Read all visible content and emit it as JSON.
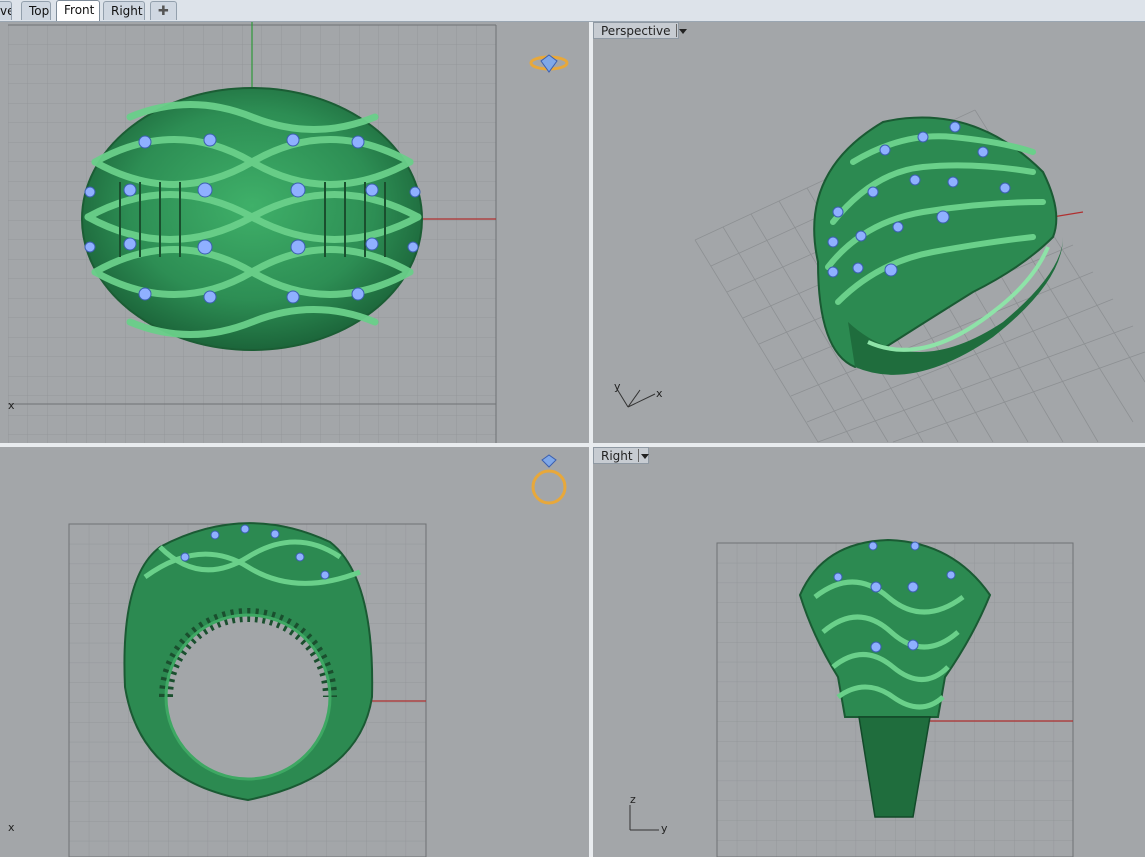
{
  "tabs": [
    {
      "label": "ve",
      "active": false
    },
    {
      "label": "Top",
      "active": false
    },
    {
      "label": "Front",
      "active": true
    },
    {
      "label": "Right",
      "active": false
    }
  ],
  "add_tab_icon": "plus-icon",
  "viewports": {
    "perspective": {
      "label": "Perspective",
      "axis_x": "x",
      "axis_y": "y"
    },
    "right": {
      "label": "Right",
      "axis_z": "z",
      "axis_y": "y"
    },
    "front": {
      "axis_x": "x"
    },
    "top": {
      "axis_x": "x"
    }
  },
  "colors": {
    "ring": "#3a9a5a",
    "ring_dark": "#1c6b38",
    "ring_light": "#7fdc98",
    "gem": "#8fb0ff",
    "grid": "#8e9194",
    "grid_major": "#6f7275",
    "axis_x": "#b03030",
    "axis_y": "#2f9a3a",
    "gumball": "#e8a83a"
  }
}
